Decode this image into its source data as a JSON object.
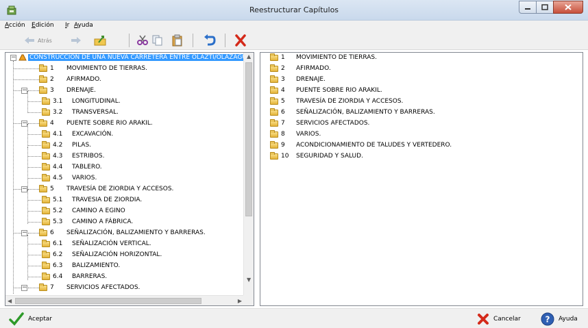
{
  "window": {
    "title": "Reestructurar Capítulos"
  },
  "menu": {
    "items": [
      "Acción",
      "Edición",
      "Ir",
      "Ayuda"
    ]
  },
  "toolbar": {
    "back_label": "Atrás"
  },
  "tree": {
    "root": "CONSTRUCCION DE UNA NUEVA CARRETERA ENTRE OLAZTI/OLAZAGU",
    "items": [
      {
        "num": "1",
        "label": "MOVIMIENTO DE TIERRAS."
      },
      {
        "num": "2",
        "label": "AFIRMADO."
      },
      {
        "num": "3",
        "label": "DRENAJE."
      },
      {
        "num": "3.1",
        "label": "LONGITUDINAL."
      },
      {
        "num": "3.2",
        "label": "TRANSVERSAL."
      },
      {
        "num": "4",
        "label": "PUENTE SOBRE RIO ARAKIL."
      },
      {
        "num": "4.1",
        "label": "EXCAVACIÓN."
      },
      {
        "num": "4.2",
        "label": "PILAS."
      },
      {
        "num": "4.3",
        "label": "ESTRIBOS."
      },
      {
        "num": "4.4",
        "label": "TABLERO."
      },
      {
        "num": "4.5",
        "label": "VARIOS."
      },
      {
        "num": "5",
        "label": "TRAVESÍA DE ZIORDIA Y ACCESOS."
      },
      {
        "num": "5.1",
        "label": "TRAVESIA DE ZIORDIA."
      },
      {
        "num": "5.2",
        "label": "CAMINO A EGINO"
      },
      {
        "num": "5.3",
        "label": "CAMINO A FÁBRICA."
      },
      {
        "num": "6",
        "label": "SEÑALIZACIÓN, BALIZAMIENTO Y BARRERAS."
      },
      {
        "num": "6.1",
        "label": "SEÑALIZACIÓN VERTICAL."
      },
      {
        "num": "6.2",
        "label": "SEÑALIZACIÓN HORIZONTAL."
      },
      {
        "num": "6.3",
        "label": "BALIZAMIENTO."
      },
      {
        "num": "6.4",
        "label": "BARRERAS."
      },
      {
        "num": "7",
        "label": "SERVICIOS AFECTADOS."
      }
    ]
  },
  "list": {
    "items": [
      {
        "num": "1",
        "label": "MOVIMIENTO DE TIERRAS."
      },
      {
        "num": "2",
        "label": "AFIRMADO."
      },
      {
        "num": "3",
        "label": "DRENAJE."
      },
      {
        "num": "4",
        "label": "PUENTE SOBRE RIO ARAKIL."
      },
      {
        "num": "5",
        "label": "TRAVESÍA DE ZIORDIA Y ACCESOS."
      },
      {
        "num": "6",
        "label": "SEÑALIZACIÓN, BALIZAMIENTO Y BARRERAS."
      },
      {
        "num": "7",
        "label": "SERVICIOS AFECTADOS."
      },
      {
        "num": "8",
        "label": "VARIOS."
      },
      {
        "num": "9",
        "label": "ACONDICIONAMIENTO DE TALUDES Y VERTEDERO."
      },
      {
        "num": "10",
        "label": "SEGURIDAD Y SALUD."
      }
    ]
  },
  "buttons": {
    "accept": "Aceptar",
    "cancel": "Cancelar",
    "help": "Ayuda"
  },
  "colors": {
    "selection": "#3399ff",
    "folder": "#f0c850"
  }
}
